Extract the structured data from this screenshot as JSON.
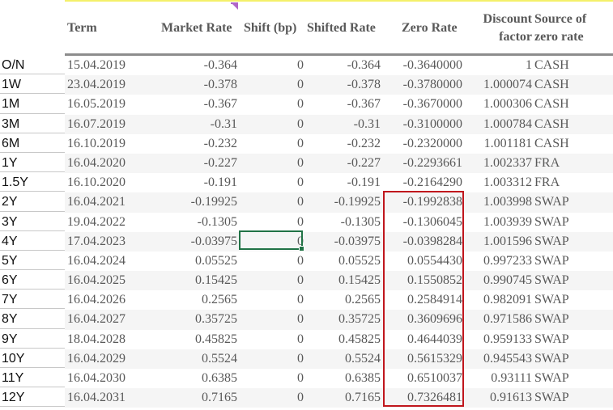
{
  "columns": {
    "term": "Term",
    "market_rate": "Market Rate",
    "shift": "Shift (bp)",
    "shifted_rate": "Shifted Rate",
    "zero_rate": "Zero Rate",
    "discount_factor_line1": "Discount",
    "discount_factor_line2": "factor",
    "source_line1": "Source of",
    "source_line2": "zero rate"
  },
  "rows": [
    {
      "tenor": "O/N",
      "date": "15.04.2019",
      "market_rate": "-0.364",
      "shift": "0",
      "shifted_rate": "-0.364",
      "zero_rate": "-0.3640000",
      "discount_factor": "1",
      "source": "CASH"
    },
    {
      "tenor": "1W",
      "date": "23.04.2019",
      "market_rate": "-0.378",
      "shift": "0",
      "shifted_rate": "-0.378",
      "zero_rate": "-0.3780000",
      "discount_factor": "1.000074",
      "source": "CASH"
    },
    {
      "tenor": "1M",
      "date": "16.05.2019",
      "market_rate": "-0.367",
      "shift": "0",
      "shifted_rate": "-0.367",
      "zero_rate": "-0.3670000",
      "discount_factor": "1.000306",
      "source": "CASH"
    },
    {
      "tenor": "3M",
      "date": "16.07.2019",
      "market_rate": "-0.31",
      "shift": "0",
      "shifted_rate": "-0.31",
      "zero_rate": "-0.3100000",
      "discount_factor": "1.000784",
      "source": "CASH"
    },
    {
      "tenor": "6M",
      "date": "16.10.2019",
      "market_rate": "-0.232",
      "shift": "0",
      "shifted_rate": "-0.232",
      "zero_rate": "-0.2320000",
      "discount_factor": "1.001181",
      "source": "CASH"
    },
    {
      "tenor": "1Y",
      "date": "16.04.2020",
      "market_rate": "-0.227",
      "shift": "0",
      "shifted_rate": "-0.227",
      "zero_rate": "-0.2293661",
      "discount_factor": "1.002337",
      "source": "FRA"
    },
    {
      "tenor": "1.5Y",
      "date": "16.10.2020",
      "market_rate": "-0.191",
      "shift": "0",
      "shifted_rate": "-0.191",
      "zero_rate": "-0.2164290",
      "discount_factor": "1.003312",
      "source": "FRA"
    },
    {
      "tenor": "2Y",
      "date": "16.04.2021",
      "market_rate": "-0.19925",
      "shift": "0",
      "shifted_rate": "-0.19925",
      "zero_rate": "-0.1992838",
      "discount_factor": "1.003998",
      "source": "SWAP"
    },
    {
      "tenor": "3Y",
      "date": "19.04.2022",
      "market_rate": "-0.1305",
      "shift": "0",
      "shifted_rate": "-0.1305",
      "zero_rate": "-0.1306045",
      "discount_factor": "1.003939",
      "source": "SWAP"
    },
    {
      "tenor": "4Y",
      "date": "17.04.2023",
      "market_rate": "-0.03975",
      "shift": "0",
      "shifted_rate": "-0.03975",
      "zero_rate": "-0.0398284",
      "discount_factor": "1.001596",
      "source": "SWAP"
    },
    {
      "tenor": "5Y",
      "date": "16.04.2024",
      "market_rate": "0.05525",
      "shift": "0",
      "shifted_rate": "0.05525",
      "zero_rate": "0.0554430",
      "discount_factor": "0.997233",
      "source": "SWAP"
    },
    {
      "tenor": "6Y",
      "date": "16.04.2025",
      "market_rate": "0.15425",
      "shift": "0",
      "shifted_rate": "0.15425",
      "zero_rate": "0.1550852",
      "discount_factor": "0.990745",
      "source": "SWAP"
    },
    {
      "tenor": "7Y",
      "date": "16.04.2026",
      "market_rate": "0.2565",
      "shift": "0",
      "shifted_rate": "0.2565",
      "zero_rate": "0.2584914",
      "discount_factor": "0.982091",
      "source": "SWAP"
    },
    {
      "tenor": "8Y",
      "date": "16.04.2027",
      "market_rate": "0.35725",
      "shift": "0",
      "shifted_rate": "0.35725",
      "zero_rate": "0.3609696",
      "discount_factor": "0.971586",
      "source": "SWAP"
    },
    {
      "tenor": "9Y",
      "date": "18.04.2028",
      "market_rate": "0.45825",
      "shift": "0",
      "shifted_rate": "0.45825",
      "zero_rate": "0.4644039",
      "discount_factor": "0.959133",
      "source": "SWAP"
    },
    {
      "tenor": "10Y",
      "date": "16.04.2029",
      "market_rate": "0.5524",
      "shift": "0",
      "shifted_rate": "0.5524",
      "zero_rate": "0.5615329",
      "discount_factor": "0.945543",
      "source": "SWAP"
    },
    {
      "tenor": "11Y",
      "date": "16.04.2030",
      "market_rate": "0.6385",
      "shift": "0",
      "shifted_rate": "0.6385",
      "zero_rate": "0.6510037",
      "discount_factor": "0.93111",
      "source": "SWAP"
    },
    {
      "tenor": "12Y",
      "date": "16.04.2031",
      "market_rate": "0.7165",
      "shift": "0",
      "shifted_rate": "0.7165",
      "zero_rate": "0.7326481",
      "discount_factor": "0.91613",
      "source": "SWAP"
    }
  ],
  "selection": {
    "row": "4Y",
    "column": "Shift (bp)",
    "value": "0"
  },
  "highlight": {
    "column": "Zero Rate",
    "from_row": "2Y",
    "to_row": "12Y",
    "color": "#c0161d"
  },
  "colors": {
    "selection_border": "#217346",
    "header_text": "#595959",
    "comment_marker": "#b066c8"
  }
}
